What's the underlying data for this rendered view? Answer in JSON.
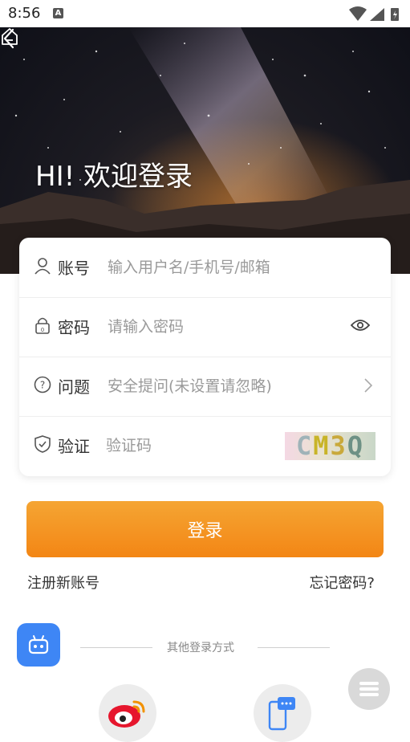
{
  "status_bar": {
    "time": "8:56",
    "notification_icon": "a-icon",
    "icons": [
      "wifi-icon",
      "signal-icon",
      "battery-icon"
    ]
  },
  "header": {
    "back_icon": "chevron-left-icon",
    "home_icon": "home-icon",
    "title": "HI! 欢迎登录"
  },
  "form": {
    "account": {
      "label": "账号",
      "placeholder": "输入用户名/手机号/邮箱",
      "value": "",
      "icon": "user-icon"
    },
    "password": {
      "label": "密码",
      "placeholder": "请输入密码",
      "value": "",
      "icon": "lock-icon",
      "toggle_icon": "eye-icon"
    },
    "question": {
      "label": "问题",
      "placeholder": "安全提问(未设置请忽略)",
      "value": "",
      "icon": "question-circle-icon",
      "chevron_icon": "chevron-right-icon"
    },
    "captcha": {
      "label": "验证",
      "placeholder": "验证码",
      "value": "",
      "icon": "shield-icon",
      "captcha_text": [
        "C",
        "M",
        "3",
        "Q"
      ]
    }
  },
  "login_button": "登录",
  "links": {
    "register": "注册新账号",
    "forgot": "忘记密码?"
  },
  "other_login": {
    "text": "其他登录方式",
    "methods": [
      "weibo-icon",
      "sms-icon"
    ]
  },
  "floating": {
    "robot_icon": "robot-icon",
    "menu_icon": "menu-icon"
  },
  "colors": {
    "accent": "#f5931f",
    "robot_bg": "#3e86f5"
  }
}
